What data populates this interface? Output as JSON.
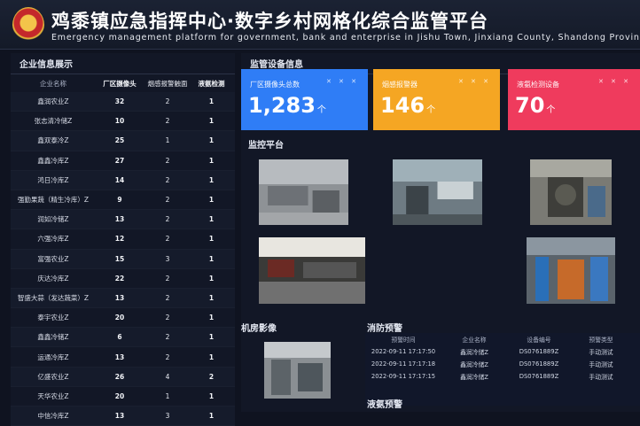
{
  "header": {
    "title": "鸡黍镇应急指挥中心·数字乡村网格化综合监管平台",
    "subtitle": "Emergency management platform for government, bank and enterprise in Jishu Town, Jinxiang County, Shandong Province"
  },
  "left_panel": {
    "title": "企业信息展示",
    "columns": [
      "企业名称",
      "厂区摄像头",
      "烟感报警触面",
      "液氨检测"
    ],
    "rows": [
      {
        "name": "鑫润农业Z",
        "cams": "32",
        "smoke": "2",
        "ammonia": "1"
      },
      {
        "name": "张志清冷储Z",
        "cams": "10",
        "smoke": "2",
        "ammonia": "1"
      },
      {
        "name": "鑫双泰冷Z",
        "cams": "25",
        "smoke": "1",
        "ammonia": "1"
      },
      {
        "name": "鑫鑫冷库Z",
        "cams": "27",
        "smoke": "2",
        "ammonia": "1"
      },
      {
        "name": "鸿日冷库Z",
        "cams": "14",
        "smoke": "2",
        "ammonia": "1"
      },
      {
        "name": "强勤果蔬（精生冷库）Z",
        "cams": "9",
        "smoke": "2",
        "ammonia": "1"
      },
      {
        "name": "润如冷储Z",
        "cams": "13",
        "smoke": "2",
        "ammonia": "1"
      },
      {
        "name": "六强冷库Z",
        "cams": "12",
        "smoke": "2",
        "ammonia": "1"
      },
      {
        "name": "富强农业Z",
        "cams": "15",
        "smoke": "3",
        "ammonia": "1"
      },
      {
        "name": "庆达冷库Z",
        "cams": "22",
        "smoke": "2",
        "ammonia": "1"
      },
      {
        "name": "智盛大蒜（发达蔬菜）Z",
        "cams": "13",
        "smoke": "2",
        "ammonia": "1"
      },
      {
        "name": "泰宇农业Z",
        "cams": "20",
        "smoke": "2",
        "ammonia": "1"
      },
      {
        "name": "鑫鑫冷储Z",
        "cams": "6",
        "smoke": "2",
        "ammonia": "1"
      },
      {
        "name": "运通冷库Z",
        "cams": "13",
        "smoke": "2",
        "ammonia": "1"
      },
      {
        "name": "亿盛农业Z",
        "cams": "26",
        "smoke": "4",
        "ammonia": "2"
      },
      {
        "name": "天华农业Z",
        "cams": "20",
        "smoke": "1",
        "ammonia": "1"
      },
      {
        "name": "中信冷库Z",
        "cams": "13",
        "smoke": "3",
        "ammonia": "1"
      }
    ]
  },
  "monitor_panel": {
    "title": "监管设备信息",
    "cards": [
      {
        "label": "厂区摄像头总数",
        "value": "1,283",
        "unit": "个",
        "color": "#2f7df6"
      },
      {
        "label": "烟感报警器",
        "value": "146",
        "unit": "个",
        "color": "#f5a623"
      },
      {
        "label": "液氨检测设备",
        "value": "70",
        "unit": "个",
        "color": "#ef3b5d"
      }
    ],
    "platform_title": "监控平台"
  },
  "bottom": {
    "machine_room_title": "机房影像",
    "fire_title": "消防预警",
    "fire_columns": [
      "预警时间",
      "企业名称",
      "设备编号",
      "预警类型"
    ],
    "fire_rows": [
      {
        "time": "2022-09-11 17:17:50",
        "company": "鑫润冷储Z",
        "device": "DS0761889Z",
        "type": "手动测试"
      },
      {
        "time": "2022-09-11 17:17:18",
        "company": "鑫润冷储Z",
        "device": "DS0761889Z",
        "type": "手动测试"
      },
      {
        "time": "2022-09-11 17:17:15",
        "company": "鑫润冷储Z",
        "device": "DS0761889Z",
        "type": "手动测试"
      }
    ],
    "ammonia_title": "液氨预警"
  }
}
